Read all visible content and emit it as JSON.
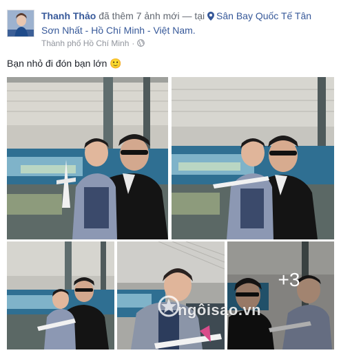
{
  "post": {
    "author": "Thanh Thảo",
    "action": "đã thêm 7 ảnh mới — tại",
    "location": "Sân Bay Quốc Tế Tân Sơn Nhất - Hồ Chí Minh - Việt Nam.",
    "meta_place": "Thành phố Hồ Chí Minh",
    "caption": "Bạn nhỏ đi đón bạn lớn",
    "emoji": "🙂",
    "photos_more": "+3",
    "watermark": "ngôisao.vn"
  },
  "icons": {
    "location_pin": "map-pin-icon",
    "privacy": "globe-icon"
  },
  "colors": {
    "link": "#365899",
    "meta": "#90949c"
  }
}
